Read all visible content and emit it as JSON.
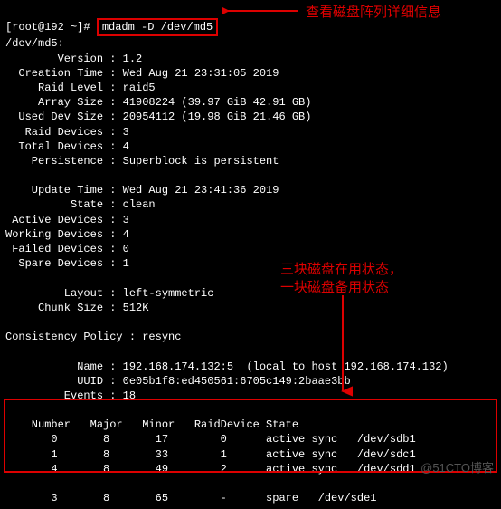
{
  "prompt": "[root@192 ~]# ",
  "command": "mdadm -D /dev/md5",
  "device_header": "/dev/md5:",
  "fields": {
    "version_label": "        Version :",
    "version_val": "1.2",
    "creation_label": "  Creation Time :",
    "creation_val": "Wed Aug 21 23:31:05 2019",
    "raidlevel_label": "     Raid Level :",
    "raidlevel_val": "raid5",
    "arraysize_label": "     Array Size :",
    "arraysize_val": "41908224 (39.97 GiB 42.91 GB)",
    "useddev_label": "  Used Dev Size :",
    "useddev_val": "20954112 (19.98 GiB 21.46 GB)",
    "raiddev_label": "   Raid Devices :",
    "raiddev_val": "3",
    "totaldev_label": "  Total Devices :",
    "totaldev_val": "4",
    "persist_label": "    Persistence :",
    "persist_val": "Superblock is persistent",
    "update_label": "    Update Time :",
    "update_val": "Wed Aug 21 23:41:36 2019",
    "state_label": "          State :",
    "state_val": "clean",
    "active_label": " Active Devices :",
    "active_val": "3",
    "working_label": "Working Devices :",
    "working_val": "4",
    "failed_label": " Failed Devices :",
    "failed_val": "0",
    "spare_label": "  Spare Devices :",
    "spare_val": "1",
    "layout_label": "         Layout :",
    "layout_val": "left-symmetric",
    "chunk_label": "     Chunk Size :",
    "chunk_val": "512K",
    "consist_label": "Consistency Policy :",
    "consist_val": "resync",
    "name_label": "           Name :",
    "name_val": "192.168.174.132:5  (local to host 192.168.174.132)",
    "uuid_label": "           UUID :",
    "uuid_val": "0e05b1f8:ed450561:6705c149:2baae3bb",
    "events_label": "         Events :",
    "events_val": "18"
  },
  "table_header": "    Number   Major   Minor   RaidDevice State",
  "table_rows": [
    "       0       8       17        0      active sync   /dev/sdb1",
    "       1       8       33        1      active sync   /dev/sdc1",
    "       4       8       49        2      active sync   /dev/sdd1",
    "",
    "       3       8       65        -      spare   /dev/sde1"
  ],
  "annotations": {
    "top": "查看磁盘阵列详细信息",
    "mid1": "三块磁盘在用状态，",
    "mid2": "一块磁盘备用状态"
  },
  "watermark": "@51CTO博客"
}
